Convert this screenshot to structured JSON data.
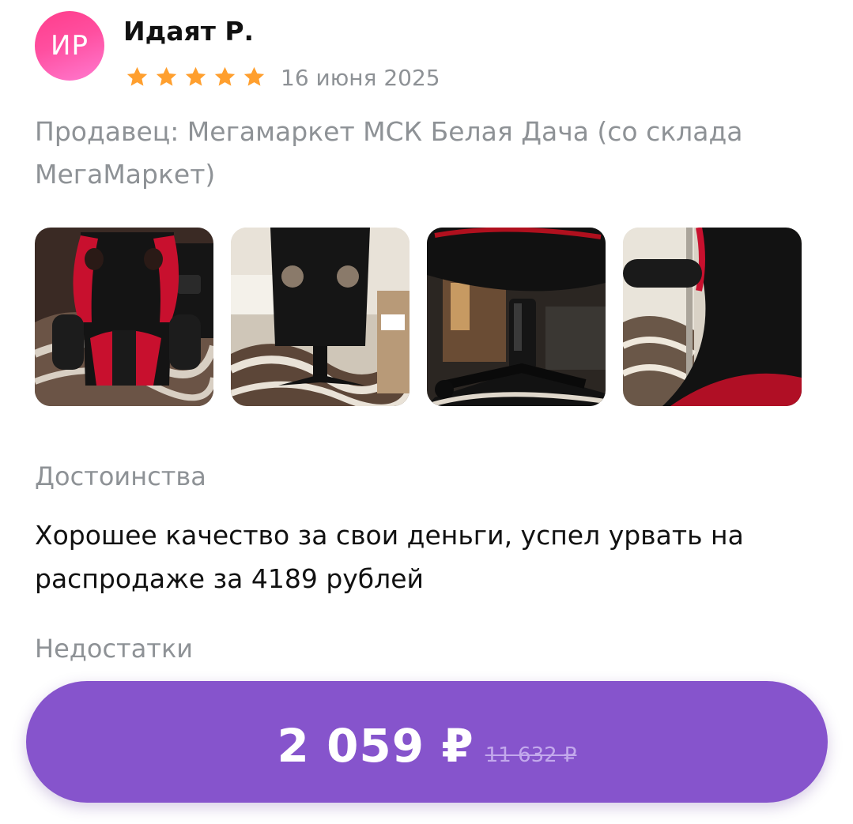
{
  "review": {
    "avatar_initials": "ИР",
    "author": "Идаят Р.",
    "rating": 5,
    "rating_max": 5,
    "date": "16 июня 2025",
    "seller": "Продавец: Мегамаркет МСК Белая Дача (со склада МегаМаркет)",
    "photos": [
      "photo-chair-front",
      "photo-chair-back",
      "photo-chair-base",
      "photo-chair-side"
    ],
    "pros_title": "Достоинства",
    "pros_text": "Хорошее качество за свои деньги, успел урвать на распродаже за 4189 рублей",
    "cons_title": "Недостатки"
  },
  "purchase": {
    "price": "2 059 ₽",
    "old_price": "11 632 ₽"
  },
  "colors": {
    "button": "#8654cc",
    "star": "#ff9f2e",
    "avatar_gradient_start": "#ff3d8b",
    "avatar_gradient_end": "#ff7ad0",
    "muted_text": "#8e9296"
  }
}
